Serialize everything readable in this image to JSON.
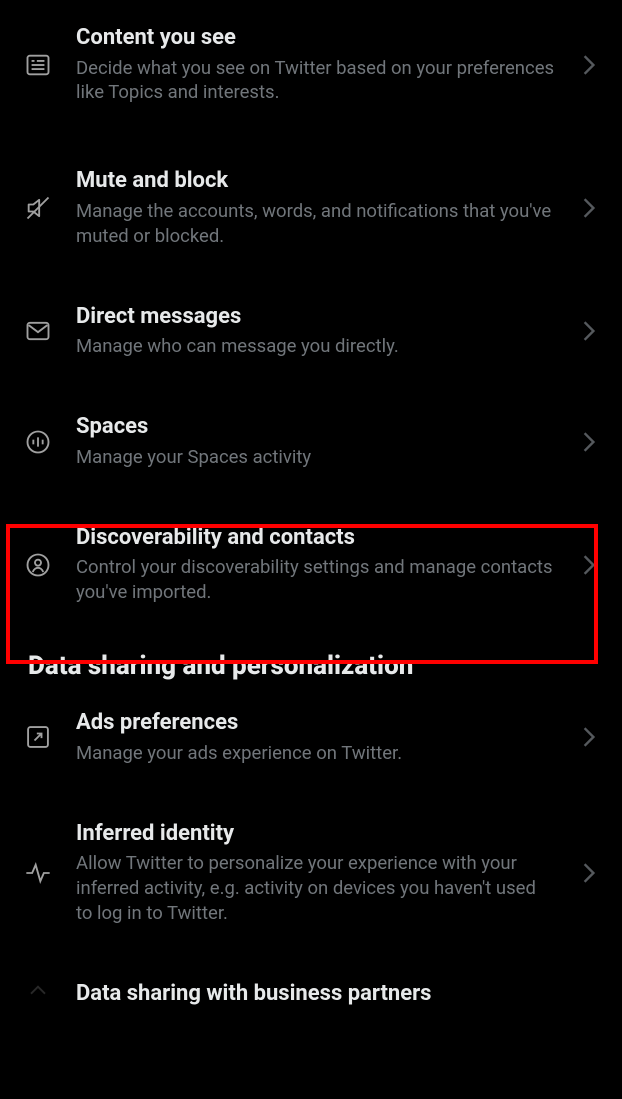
{
  "section1": {
    "items": [
      {
        "icon": "content-icon",
        "title": "Content you see",
        "desc": "Decide what you see on Twitter based on your preferences like Topics and interests."
      },
      {
        "icon": "mute-icon",
        "title": "Mute and block",
        "desc": "Manage the accounts, words, and notifications that you've muted or blocked."
      },
      {
        "icon": "envelope-icon",
        "title": "Direct messages",
        "desc": "Manage who can message you directly."
      },
      {
        "icon": "spaces-icon",
        "title": "Spaces",
        "desc": "Manage your Spaces activity"
      },
      {
        "icon": "discover-icon",
        "title": "Discoverability and contacts",
        "desc": "Control your discoverability settings and manage contacts you've imported."
      }
    ]
  },
  "section2": {
    "heading": "Data sharing and personalization",
    "items": [
      {
        "icon": "ads-icon",
        "title": "Ads preferences",
        "desc": "Manage your ads experience on Twitter."
      },
      {
        "icon": "activity-icon",
        "title": "Inferred identity",
        "desc": "Allow Twitter to personalize your experience with your inferred activity, e.g. activity on devices you haven't used to log in to Twitter."
      },
      {
        "icon": "share-icon",
        "title": "Data sharing with business partners",
        "desc": ""
      }
    ]
  },
  "colors": {
    "accent_highlight": "#ff0000",
    "text_primary": "#e7e9ea",
    "text_secondary": "#71767b"
  }
}
